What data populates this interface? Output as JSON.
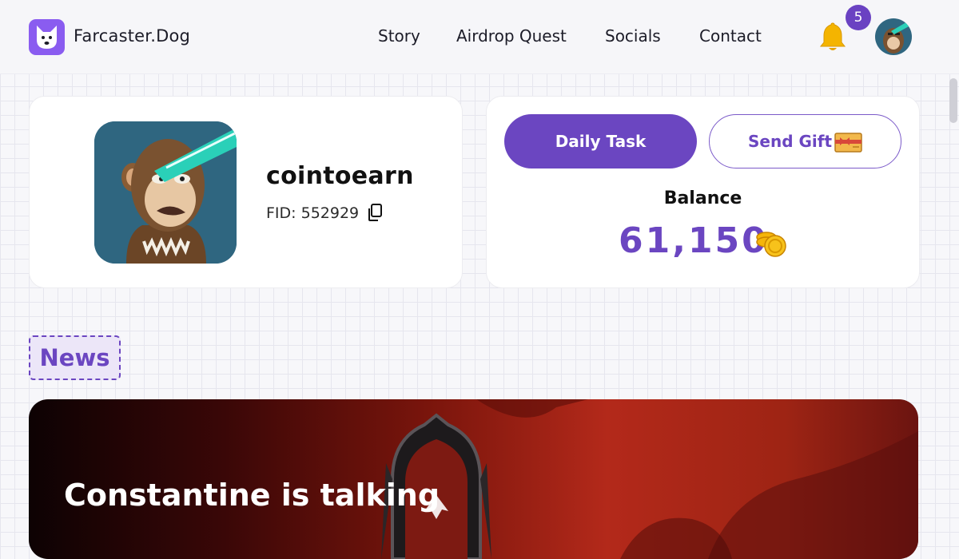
{
  "header": {
    "brand": "Farcaster.Dog",
    "nav": [
      "Story",
      "Airdrop Quest",
      "Socials",
      "Contact"
    ],
    "notification_count": "5",
    "icons": {
      "logo": "dog-logo-icon",
      "bell": "bell-icon",
      "avatar": "ape-avatar"
    }
  },
  "profile": {
    "username": "cointoearn",
    "fid_label": "FID: 552929",
    "copy_icon": "copy-icon"
  },
  "wallet": {
    "daily_task_label": "Daily Task",
    "send_gift_label": "Send Gift",
    "balance_title": "Balance",
    "balance_value": "61,150",
    "icons": {
      "gift": "gift-icon",
      "coin": "coin-stack-icon"
    }
  },
  "news": {
    "section_label": "News",
    "headline": "Constantine is talking"
  },
  "colors": {
    "accent": "#6b46c1",
    "logo_bg": "#8a5cf0",
    "badge": "#6a42c2",
    "bell": "#f4b400",
    "coin": "#f5b50a"
  }
}
